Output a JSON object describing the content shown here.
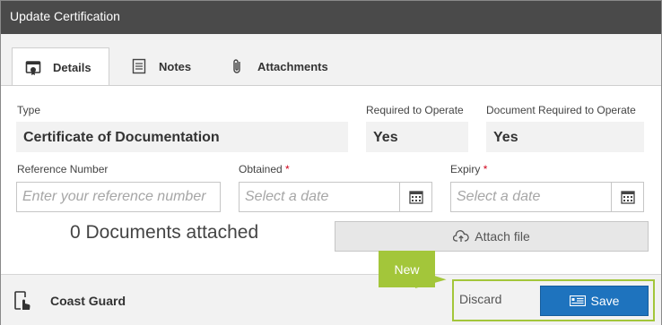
{
  "window": {
    "title": "Update Certification"
  },
  "tabs": [
    {
      "label": "Details",
      "icon": "certificate-icon",
      "active": true
    },
    {
      "label": "Notes",
      "icon": "notes-icon",
      "active": false
    },
    {
      "label": "Attachments",
      "icon": "paperclip-icon",
      "active": false
    }
  ],
  "details": {
    "type_label": "Type",
    "type_value": "Certificate of Documentation",
    "required_label": "Required to Operate",
    "required_value": "Yes",
    "doc_required_label": "Document Required to Operate",
    "doc_required_value": "Yes",
    "reference_label": "Reference Number",
    "reference_placeholder": "Enter your reference number",
    "obtained_label": "Obtained",
    "obtained_placeholder": "Select a date",
    "expiry_label": "Expiry",
    "expiry_placeholder": "Select a date",
    "required_marker": "*",
    "documents_attached": "0 Documents attached",
    "attach_label": "Attach file"
  },
  "footer": {
    "organization": "Coast Guard",
    "discard_label": "Discard",
    "save_label": "Save"
  },
  "callout": {
    "text": "New"
  },
  "colors": {
    "titlebar": "#4a4a4a",
    "primary": "#1e73be",
    "accent": "#a3c63a",
    "required": "#d0021b"
  }
}
